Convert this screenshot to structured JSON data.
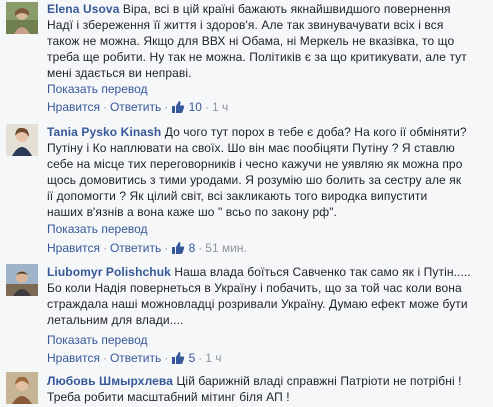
{
  "ui": {
    "translate_label": "Показать перевод",
    "like_label": "Нравится",
    "reply_label": "Ответить",
    "like_icon": "thumbs-up-icon",
    "link_color": "#365899"
  },
  "comments": [
    {
      "author": "Elena Usova",
      "lines": [
        "Віра, всі в цій країні бажають якнайшвидшого повернення",
        "Надї і збереження її життя і здоров'я. Але так звинувачувати всіх і вся",
        "також не можна. Якщо для ВВХ ні Обама, ні Меркель не вказівка, то що",
        "треба ще робити. Ну так не можна. Політиків є за що критикувати, але тут",
        "мені здається ви неправі."
      ],
      "likes": "10",
      "time": "1 ч"
    },
    {
      "author": "Tania Pysko Kinash",
      "lines": [
        "До чого тут порох в тебе є доба? На кого ії обміняти?",
        "Путіну і Ко наплювати на своїх. Шо він має пообіцяти Путіну ? Я ставлю",
        "себе на місце тих переговорників і чесно кажучи не уявляю як можна про",
        "щось домовитись з тими уродами. Я розумію шо болить за сестру але як",
        "ії допомогти ? Як цілий світ, всі закликають того виродка випустити",
        "наших в'язнів а вона каже шо \" всьо по закону рф\"."
      ],
      "likes": "8",
      "time": "51 мин."
    },
    {
      "author": "Liubomyr Polishchuk",
      "lines": [
        "Наша влада боїться Савченко так само як і Путін.....",
        "Бо коли Надія повернеться в Україну і побачить, що за той час коли вона",
        "страждала наші можновладці розривали Україну. Думаю ефект може бути",
        "летальним для влади...."
      ],
      "likes": "5",
      "time": "1 ч"
    },
    {
      "author": "Любовь Шмырхлева",
      "lines": [
        "Цій барижній владі справжні Патріоти не потрібні !",
        "Треба робити масштабний мітинг біля АП !"
      ]
    }
  ]
}
